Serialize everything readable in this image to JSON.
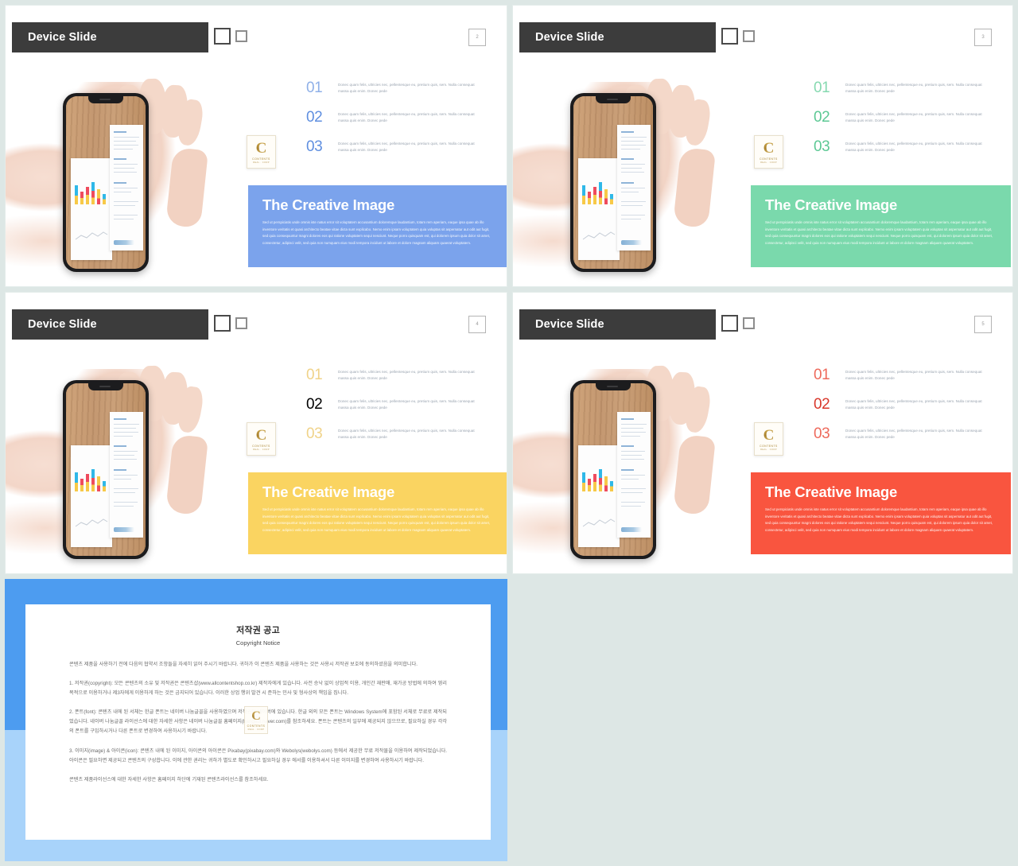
{
  "canvas": {
    "background": "#dde7e5"
  },
  "slides": [
    {
      "id": "slide-2",
      "header_title": "Device Slide",
      "page_number": "2",
      "accent": "#7ba3ec",
      "number_color": "#8fb0e8",
      "banner_title": "The Creative Image",
      "banner_body": "Sed ut perspiciatis unde omnis iste natus error sit voluptatem accusantium doloremque laudantium, totam rem aperiam, eaque ipsa quae ab illo inventore veritatis et quasi architecto beatae vitae dicta sunt explicabo. Nemo enim ipsam voluptatem quia voluptas sit aspernatur aut odit aut fugit, sed quia consequuntur magni dolores eos qui ratione voluptatem sequi nesciunt. Neque porro quisquam est, qui dolorem ipsum quia dolor sit amet, consectetur, adipisci velit, sed quia non numquam eius modi tempora incidunt ut labore et dolore magnam aliquam quaerat voluptatem.",
      "items": [
        {
          "number": "01",
          "text": "Donec quam felis, ultricies nec, pellentesque eu, pretium quis, sem. Nulla consequat massa quis enim. Donec pede"
        },
        {
          "number": "02",
          "text": "Donec quam felis, ultricies nec, pellentesque eu, pretium quis, sem. Nulla consequat massa quis enim. Donec pede"
        },
        {
          "number": "03",
          "text": "Donec quam felis, ultricies nec, pellentesque eu, pretium quis, sem. Nulla consequat massa quis enim. Donec pede"
        }
      ]
    },
    {
      "id": "slide-3",
      "header_title": "Device Slide",
      "page_number": "3",
      "accent": "#7ad9ac",
      "number_color": "#86d9b0",
      "banner_title": "The Creative Image",
      "banner_body": "Sed ut perspiciatis unde omnis iste natus error sit voluptatem accusantium doloremque laudantium, totam rem aperiam, eaque ipsa quae ab illo inventore veritatis et quasi architecto beatae vitae dicta sunt explicabo. Nemo enim ipsam voluptatem quia voluptas sit aspernatur aut odit aut fugit, sed quia consequuntur magni dolores eos qui ratione voluptatem sequi nesciunt. Neque porro quisquam est, qui dolorem ipsum quia dolor sit amet, consectetur, adipisci velit, sed quia non numquam eius modi tempora incidunt ut labore et dolore magnam aliquam quaerat voluptatem.",
      "items": [
        {
          "number": "01",
          "text": "Donec quam felis, ultricies nec, pellentesque eu, pretium quis, sem. Nulla consequat massa quis enim. Donec pede"
        },
        {
          "number": "02",
          "text": "Donec quam felis, ultricies nec, pellentesque eu, pretium quis, sem. Nulla consequat massa quis enim. Donec pede"
        },
        {
          "number": "03",
          "text": "Donec quam felis, ultricies nec, pellentesque eu, pretium quis, sem. Nulla consequat massa quis enim. Donec pede"
        }
      ]
    },
    {
      "id": "slide-4",
      "header_title": "Device Slide",
      "page_number": "4",
      "accent": "#fad461",
      "number_color": "#f3d070",
      "banner_title": "The Creative Image",
      "banner_body": "Sed ut perspiciatis unde omnis iste natus error sit voluptatem accusantium doloremque laudantium, totam rem aperiam, eaque ipsa quae ab illo inventore veritatis et quasi architecto beatae vitae dicta sunt explicabo. Nemo enim ipsam voluptatem quia voluptas sit aspernatur aut odit aut fugit, sed quia consequuntur magni dolores eos qui ratione voluptatem sequi nesciunt. Neque porro quisquam est, qui dolorem ipsum quia dolor sit amet, consectetur, adipisci velit, sed quia non numquam eius modi tempora incidunt ut labore et dolore magnam aliquam quaerat voluptatem.",
      "items": [
        {
          "number": "01",
          "text": "Donec quam felis, ultricies nec, pellentesque eu, pretium quis, sem. Nulla consequat massa quis enim. Donec pede"
        },
        {
          "number": "02",
          "text": "Donec quam felis, ultricies nec, pellentesque eu, pretium quis, sem. Nulla consequat massa quis enim. Donec pede"
        },
        {
          "number": "03",
          "text": "Donec quam felis, ultricies nec, pellentesque eu, pretium quis, sem. Nulla consequat massa quis enim. Donec pede"
        }
      ]
    },
    {
      "id": "slide-5",
      "header_title": "Device Slide",
      "page_number": "5",
      "accent": "#f9553f",
      "number_color": "#e8574a",
      "banner_title": "The Creative Image",
      "banner_body": "Sed ut perspiciatis unde omnis iste natus error sit voluptatem accusantium doloremque laudantium, totam rem aperiam, eaque ipsa quae ab illo inventore veritatis et quasi architecto beatae vitae dicta sunt explicabo. Nemo enim ipsam voluptatem quia voluptas sit aspernatur aut odit aut fugit, sed quia consequuntur magni dolores eos qui ratione voluptatem sequi nesciunt. Neque porro quisquam est, qui dolorem ipsum quia dolor sit amet, consectetur, adipisci velit, sed quia non numquam eius modi tempora incidunt ut labore et dolore magnam aliquam quaerat voluptatem.",
      "items": [
        {
          "number": "01",
          "text": "Donec quam felis, ultricies nec, pellentesque eu, pretium quis, sem. Nulla consequat massa quis enim. Donec pede"
        },
        {
          "number": "02",
          "text": "Donec quam felis, ultricies nec, pellentesque eu, pretium quis, sem. Nulla consequat massa quis enim. Donec pede"
        },
        {
          "number": "03",
          "text": "Donec quam felis, ultricies nec, pellentesque eu, pretium quis, sem. Nulla consequat massa quis enim. Donec pede"
        }
      ]
    }
  ],
  "logo": {
    "letter": "C",
    "line1": "CONTENTS",
    "line2": "REAL . CORP"
  },
  "copyright": {
    "frame_color": "#4d9cf0",
    "title": "저작권 공고",
    "subtitle": "Copyright Notice",
    "intro": "콘텐츠 제품을 사용하기 전에 다음의 협약서 조항들을 자세히 읽어 주시기 바랍니다. 귀하가 이 콘텐츠 제품을 사용하는 것은 사용시 저작권 보호에 동의하셨음을 의미합니다.",
    "section1": "1. 저작권(copyright): 모든 콘텐츠의 소유 및 저작권은 콘텐츠샵(www.allcontentshop.co.kr) 제작자에게 있습니다. 사전 승낙 없이 상업적 이용, 개인간 재판매, 재가공 방법에 의하여 영리 목적으로 이용하거나 제3자에게 이용하게 하는 것은 금지되어 있습니다. 이러한 상업 행위 발견 시 준하는 민사 및 형사상의 책임을 집니다.",
    "section2": "2. 폰트(font): 콘텐츠 내에 된 서체는 한글 폰트는 네이버 나눔글꼴을 사용하였으며 저작권이 네이버에 있습니다. 한글 외의 모든 폰트는 Windows System에 포함된 서체로 무료로 제작되었습니다. 네이버 나눔글꼴 라이선스에 대한 자세한 사항은 네이버 나눔글꼴 홈페이지(hangeul.naver.com)를 참조하세요. 폰트는 콘텐츠의 일부에 제공되지 않으므로, 필요하실 경우 각각의 폰트를 구입하시거나 다른 폰트로 변경하여 사용하시기 바랍니다.",
    "section3": "3. 이미지(image) & 아이콘(icon): 콘텐츠 내에 된 이미지, 아이콘의 아이콘은 Pixabay(pixabay.com)와 Webolys(webolys.com) 등에서 제공한 무료 저작물을 이용하여 제작되었습니다. 아이콘은 필요하면 제공되고 콘텐츠의 구성합니다. 이에 관한 권리는 귀하가 별도로 확인하시고 필요하실 경우 에서를 이용하셔서 다른 이미지를 변경하여 사용하시기 바랍니다.",
    "outro": "콘텐츠 제품라이선스에 대한 자세한 사항은 홈페이지 하단에 기재된 콘텐츠라이선스를 참조하세요."
  }
}
